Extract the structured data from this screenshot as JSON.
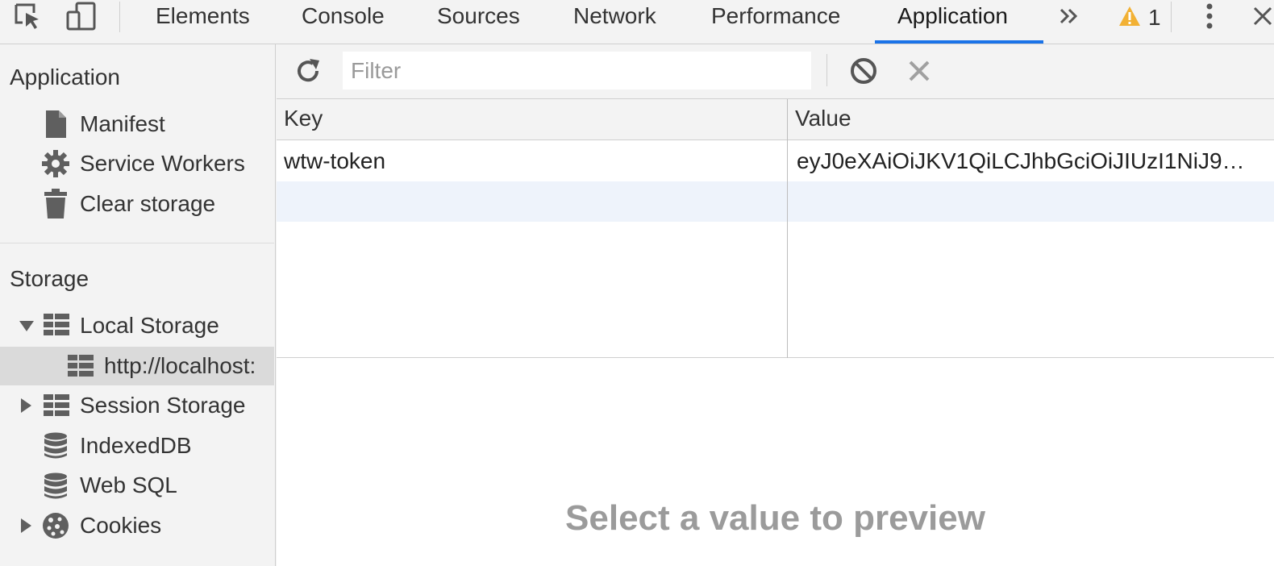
{
  "toolbar": {
    "tabs": [
      {
        "label": "Elements"
      },
      {
        "label": "Console"
      },
      {
        "label": "Sources"
      },
      {
        "label": "Network"
      },
      {
        "label": "Performance"
      },
      {
        "label": "Application",
        "active": true
      }
    ],
    "overflow_icon": "double-chevron-right",
    "warning_count": "1"
  },
  "sidebar": {
    "sections": [
      {
        "title": "Application",
        "items": [
          {
            "label": "Manifest",
            "icon": "file-icon"
          },
          {
            "label": "Service Workers",
            "icon": "gear-icon"
          },
          {
            "label": "Clear storage",
            "icon": "trash-icon"
          }
        ]
      },
      {
        "title": "Storage",
        "items": [
          {
            "label": "Local Storage",
            "icon": "grid-icon",
            "expanded": true
          },
          {
            "label": "http://localhost:",
            "icon": "grid-icon",
            "selected": true
          },
          {
            "label": "Session Storage",
            "icon": "grid-icon",
            "expanded": false
          },
          {
            "label": "IndexedDB",
            "icon": "database-icon"
          },
          {
            "label": "Web SQL",
            "icon": "database-icon"
          },
          {
            "label": "Cookies",
            "icon": "cookie-icon",
            "expanded": false
          }
        ]
      }
    ]
  },
  "filter": {
    "placeholder": "Filter",
    "value": ""
  },
  "table": {
    "columns": [
      "Key",
      "Value"
    ],
    "rows": [
      {
        "key": "wtw-token",
        "value": "eyJ0eXAiOiJKV1QiLCJhbGciOiJIUzI1NiJ9…"
      }
    ]
  },
  "preview": {
    "message": "Select a value to preview"
  },
  "colors": {
    "accent": "#1a73e8",
    "warning": "#f2b134",
    "selection": "#dadada",
    "row_alt": "#eef3fb"
  }
}
